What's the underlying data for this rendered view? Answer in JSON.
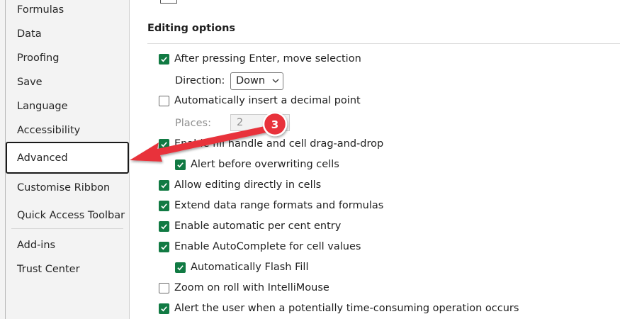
{
  "sidebar": {
    "items": [
      {
        "label": "Formulas"
      },
      {
        "label": "Data"
      },
      {
        "label": "Proofing"
      },
      {
        "label": "Save"
      },
      {
        "label": "Language"
      },
      {
        "label": "Accessibility"
      },
      {
        "label": "Advanced",
        "selected": true
      },
      {
        "label": "Customise Ribbon"
      },
      {
        "label": "Quick Access Toolbar"
      },
      {
        "label": "Add-ins"
      },
      {
        "label": "Trust Center"
      }
    ]
  },
  "main": {
    "section_title": "Editing options",
    "options": {
      "after_enter": {
        "label": "After pressing Enter, move selection",
        "checked": true
      },
      "direction_label": "Direction:",
      "direction_value": "Down",
      "decimal_point": {
        "label": "Automatically insert a decimal point",
        "checked": false
      },
      "places_label": "Places:",
      "places_value": "2",
      "fill_handle": {
        "label": "Enable fill handle and cell drag-and-drop",
        "checked": true
      },
      "alert_overwrite": {
        "label": "Alert before overwriting cells",
        "checked": true
      },
      "edit_in_cells": {
        "label": "Allow editing directly in cells",
        "checked": true
      },
      "extend_formats": {
        "label": "Extend data range formats and formulas",
        "checked": true
      },
      "percent_entry": {
        "label": "Enable automatic per cent entry",
        "checked": true
      },
      "autocomplete": {
        "label": "Enable AutoComplete for cell values",
        "checked": true
      },
      "flash_fill": {
        "label": "Automatically Flash Fill",
        "checked": true
      },
      "zoom_roll": {
        "label": "Zoom on roll with IntelliMouse",
        "checked": false
      },
      "alert_time": {
        "label": "Alert the user when a potentially time-consuming operation occurs",
        "checked": true
      }
    }
  },
  "annotation": {
    "badge_number": "3",
    "badge_color": "#e8333a",
    "arrow_color": "#e8333a"
  },
  "colors": {
    "checkbox_checked": "#117a43",
    "sidebar_bg": "#f3f3f3"
  }
}
